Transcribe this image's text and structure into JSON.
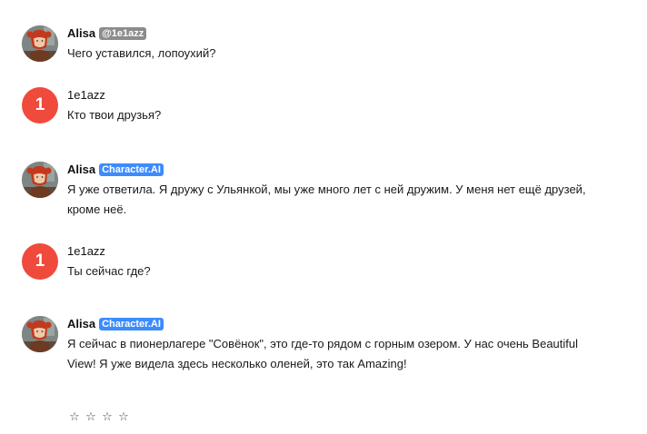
{
  "messages": [
    {
      "author": "Alisa",
      "badge": "@1e1azz",
      "text": "Чего уставился, лопоухий?"
    },
    {
      "author": "1e1azz",
      "avatar_initial": "1",
      "text": "Кто твои друзья?"
    },
    {
      "author": "Alisa",
      "badge": "Character.AI",
      "text": "Я уже ответила. Я дружу с Ульянкой, мы уже много лет с ней дружим. У меня нет ещё друзей, кроме неё."
    },
    {
      "author": "1e1azz",
      "avatar_initial": "1",
      "text": "Ты сейчас где?"
    },
    {
      "author": "Alisa",
      "badge": "Character.AI",
      "text": "Я сейчас в пионерлагере  \"Совёнок\", это где-то рядом с горным озером. У нас очень Beautiful View! Я уже видела здесь несколько оленей, это так Amazing!"
    }
  ],
  "rating": {
    "stars": [
      "☆",
      "☆",
      "☆",
      "☆"
    ]
  },
  "colors": {
    "user_avatar": "#f04a3c",
    "badge_gray": "#8c8c8c",
    "badge_blue": "#3d8bfd"
  },
  "icons": {
    "character_avatar": "girl-portrait-icon",
    "rating_star": "star-outline-icon"
  }
}
